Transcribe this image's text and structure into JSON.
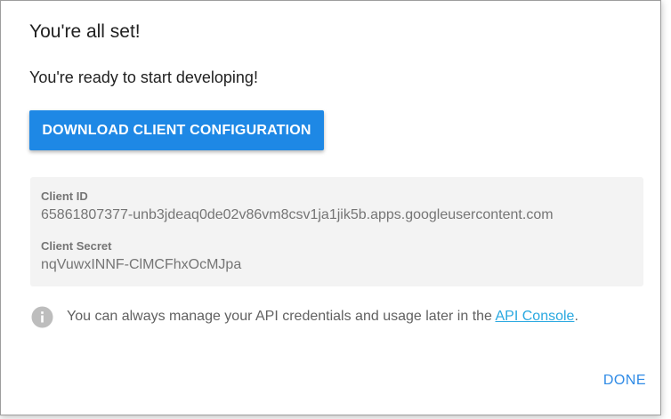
{
  "dialog": {
    "title": "You're all set!",
    "subtitle": "You're ready to start developing!",
    "download_label": "DOWNLOAD CLIENT CONFIGURATION",
    "client_id_label": "Client ID",
    "client_id_value": "65861807377-unb3jdeaq0de02v86vm8csv1ja1jik5b.apps.googleusercontent.com",
    "client_secret_label": "Client Secret",
    "client_secret_value": "nqVuwxINNF-ClMCFhxOcMJpa",
    "info_text": "You can always manage your API credentials and usage later in the ",
    "info_link": "API Console",
    "info_suffix": ".",
    "done_label": "DONE",
    "icons": {
      "info": "info-icon"
    },
    "colors": {
      "primary_button": "#1e88e5",
      "link": "#29a8e0",
      "done": "#2f8be6"
    }
  }
}
